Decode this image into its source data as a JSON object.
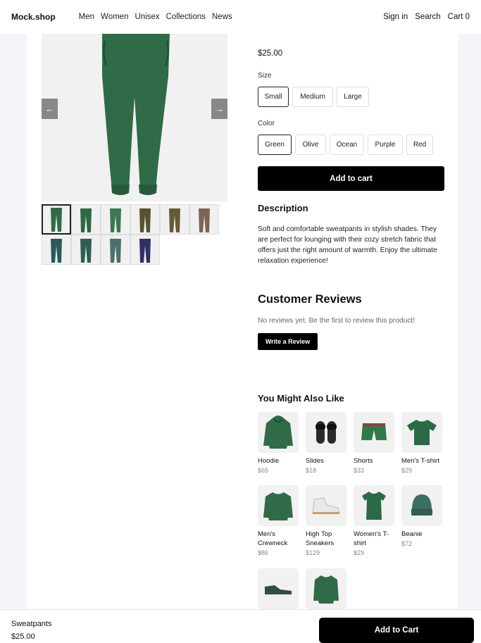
{
  "nav": {
    "brand": "Mock.shop",
    "links": [
      "Men",
      "Women",
      "Unisex",
      "Collections",
      "News"
    ],
    "sign_in": "Sign in",
    "search": "Search",
    "cart": "Cart 0"
  },
  "gallery": {
    "prev_arrow": "←",
    "next_arrow": "→",
    "thumb_colors": [
      "#2f6b47",
      "#2e6846",
      "#3b7a51",
      "#5a5131",
      "#665a33",
      "#7b6555",
      "#2b5c59",
      "#2f5e58",
      "#4f6f6b",
      "#322f6b"
    ]
  },
  "product": {
    "price": "$25.00",
    "size_label": "Size",
    "sizes": [
      "Small",
      "Medium",
      "Large"
    ],
    "color_label": "Color",
    "colors": [
      "Green",
      "Olive",
      "Ocean",
      "Purple",
      "Red"
    ],
    "add_to_cart": "Add to cart",
    "description_title": "Description",
    "description": "Soft and comfortable sweatpants in stylish shades. They are perfect for lounging with their cozy stretch fabric that offers just the right amount of warmth. Enjoy the ultimate relaxation experience!"
  },
  "reviews": {
    "title": "Customer Reviews",
    "empty": "No reviews yet. Be the first to review this product!",
    "write_button": "Write a Review"
  },
  "also_like": {
    "title": "You Might Also Like",
    "items": [
      {
        "name": "Hoodie",
        "price": "$65"
      },
      {
        "name": "Slides",
        "price": "$18"
      },
      {
        "name": "Shorts",
        "price": "$33"
      },
      {
        "name": "Men's T-shirt",
        "price": "$29"
      },
      {
        "name": "Men's Crewneck",
        "price": "$86"
      },
      {
        "name": "High Top Sneakers",
        "price": "$129"
      },
      {
        "name": "Women's T-shirt",
        "price": "$29"
      },
      {
        "name": "Beanie",
        "price": "$72"
      },
      {
        "name": "",
        "price": ""
      },
      {
        "name": "",
        "price": ""
      }
    ]
  },
  "sticky": {
    "name": "Sweatpants",
    "price": "$25.00",
    "add_to_cart": "Add to Cart"
  },
  "colors": {
    "accent": "#000000",
    "product_green": "#2f6b47"
  }
}
